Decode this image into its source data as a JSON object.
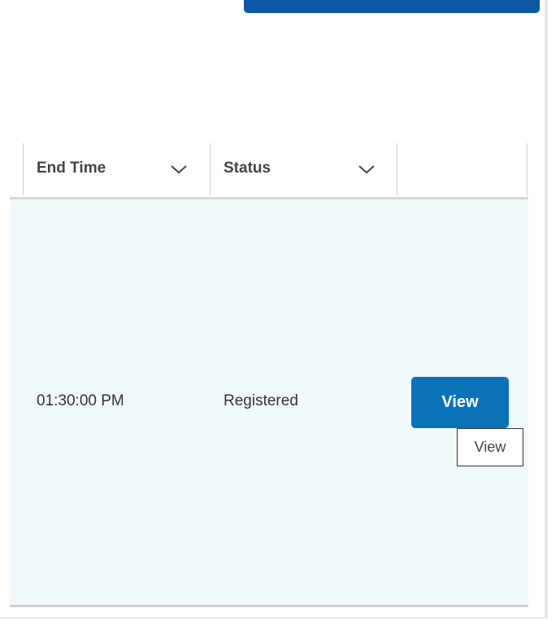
{
  "table": {
    "columns": [
      {
        "label": "End Time",
        "sortable": true
      },
      {
        "label": "Status",
        "sortable": true
      },
      {
        "label": ""
      }
    ],
    "rows": [
      {
        "end_time": "01:30:00 PM",
        "status": "Registered",
        "action_label": "View"
      }
    ]
  },
  "tooltip": {
    "text": "View"
  },
  "colors": {
    "primary_button": "#0a73b8",
    "top_button": "#0b57a4",
    "row_highlight": "#f1f8fc"
  },
  "icons": {
    "sort": "chevron-down-icon"
  }
}
